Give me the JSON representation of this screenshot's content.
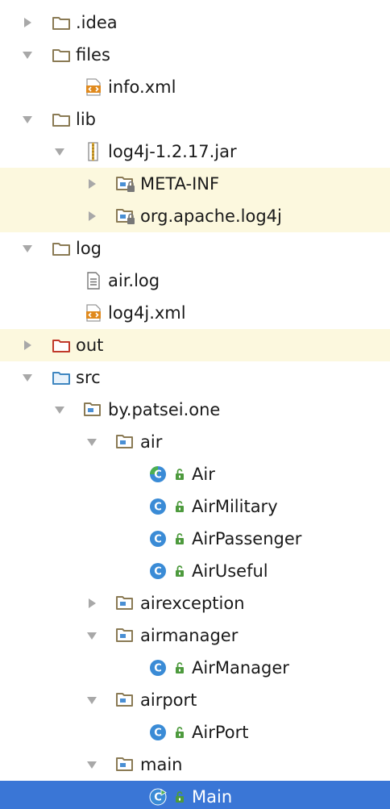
{
  "colors": {
    "folder": "#8a7a54",
    "folder_out": "#c0392b",
    "folder_src": "#3e86c0",
    "package": "#4a8fd4",
    "class": "#3a8bd6",
    "class_main_accent": "#4caf50",
    "highlight": "#fcf8de",
    "selection": "#3a76d6",
    "xml_orange": "#e08a1e",
    "lock_green": "#4d9a3d"
  },
  "tree": [
    {
      "name": "tree-item-idea",
      "label": ".idea",
      "level": 0,
      "arrow": "collapsed",
      "icon": "folder-icon",
      "highlight": false
    },
    {
      "name": "tree-item-files",
      "label": "files",
      "level": 0,
      "arrow": "expanded",
      "icon": "folder-icon",
      "highlight": false
    },
    {
      "name": "tree-item-info-xml",
      "label": "info.xml",
      "level": 1,
      "arrow": "none",
      "icon": "xml-file-icon",
      "highlight": false
    },
    {
      "name": "tree-item-lib",
      "label": "lib",
      "level": 0,
      "arrow": "expanded",
      "icon": "folder-icon",
      "highlight": false
    },
    {
      "name": "tree-item-log4j-jar",
      "label": "log4j-1.2.17.jar",
      "level": 1,
      "arrow": "expanded",
      "icon": "jar-icon",
      "highlight": false
    },
    {
      "name": "tree-item-meta-inf",
      "label": "META-INF",
      "level": 2,
      "arrow": "collapsed",
      "icon": "locked-package-icon",
      "highlight": true
    },
    {
      "name": "tree-item-org-apache-log4j",
      "label": "org.apache.log4j",
      "level": 2,
      "arrow": "collapsed",
      "icon": "locked-package-icon",
      "highlight": true
    },
    {
      "name": "tree-item-log",
      "label": "log",
      "level": 0,
      "arrow": "expanded",
      "icon": "folder-icon",
      "highlight": false
    },
    {
      "name": "tree-item-air-log",
      "label": "air.log",
      "level": 1,
      "arrow": "none",
      "icon": "text-file-icon",
      "highlight": false
    },
    {
      "name": "tree-item-log4j-xml",
      "label": "log4j.xml",
      "level": 1,
      "arrow": "none",
      "icon": "xml-file-icon",
      "highlight": false
    },
    {
      "name": "tree-item-out",
      "label": "out",
      "level": 0,
      "arrow": "collapsed",
      "icon": "excluded-folder-icon",
      "highlight": true
    },
    {
      "name": "tree-item-src",
      "label": "src",
      "level": 0,
      "arrow": "expanded",
      "icon": "source-folder-icon",
      "highlight": false
    },
    {
      "name": "tree-item-by-patsei-one",
      "label": "by.patsei.one",
      "level": 1,
      "arrow": "expanded",
      "icon": "package-icon",
      "highlight": false
    },
    {
      "name": "tree-item-air-package",
      "label": "air",
      "level": 2,
      "arrow": "expanded",
      "icon": "package-icon",
      "highlight": false
    },
    {
      "name": "tree-item-air-class",
      "label": "Air",
      "level": 3,
      "arrow": "none",
      "icon": "abstract-class-icon",
      "lock": true,
      "highlight": false
    },
    {
      "name": "tree-item-air-military",
      "label": "AirMilitary",
      "level": 3,
      "arrow": "none",
      "icon": "class-icon",
      "lock": true,
      "highlight": false
    },
    {
      "name": "tree-item-air-passenger",
      "label": "AirPassenger",
      "level": 3,
      "arrow": "none",
      "icon": "class-icon",
      "lock": true,
      "highlight": false
    },
    {
      "name": "tree-item-air-useful",
      "label": "AirUseful",
      "level": 3,
      "arrow": "none",
      "icon": "class-icon",
      "lock": true,
      "highlight": false
    },
    {
      "name": "tree-item-airexception",
      "label": "airexception",
      "level": 2,
      "arrow": "collapsed",
      "icon": "package-icon",
      "highlight": false
    },
    {
      "name": "tree-item-airmanager-package",
      "label": "airmanager",
      "level": 2,
      "arrow": "expanded",
      "icon": "package-icon",
      "highlight": false
    },
    {
      "name": "tree-item-airmanager-class",
      "label": "AirManager",
      "level": 3,
      "arrow": "none",
      "icon": "class-icon",
      "lock": true,
      "highlight": false
    },
    {
      "name": "tree-item-airport-package",
      "label": "airport",
      "level": 2,
      "arrow": "expanded",
      "icon": "package-icon",
      "highlight": false
    },
    {
      "name": "tree-item-airport-class",
      "label": "AirPort",
      "level": 3,
      "arrow": "none",
      "icon": "class-icon",
      "lock": true,
      "highlight": false
    },
    {
      "name": "tree-item-main-package",
      "label": "main",
      "level": 2,
      "arrow": "expanded",
      "icon": "package-icon",
      "highlight": false
    },
    {
      "name": "tree-item-main-class",
      "label": "Main",
      "level": 3,
      "arrow": "none",
      "icon": "main-class-icon",
      "lock": true,
      "highlight": false,
      "selected": true
    }
  ]
}
